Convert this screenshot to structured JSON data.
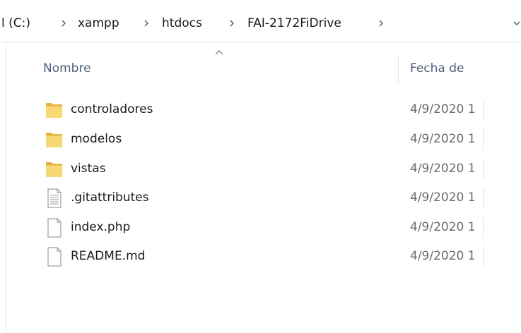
{
  "address_bar": {
    "crumbs": [
      "l (C:)",
      "xampp",
      "htdocs",
      "FAI-2172FiDrive"
    ],
    "separator_icon": "chevron-right-icon",
    "dropdown_icon": "chevron-down-icon"
  },
  "file_list": {
    "sort_icon": "sort-ascending-icon",
    "columns": {
      "name": "Nombre",
      "date": "Fecha de"
    },
    "items": [
      {
        "name": "controladores",
        "date": "4/9/2020 1",
        "type": "folder",
        "icon": "folder-icon"
      },
      {
        "name": "modelos",
        "date": "4/9/2020 1",
        "type": "folder",
        "icon": "folder-icon"
      },
      {
        "name": "vistas",
        "date": "4/9/2020 1",
        "type": "folder",
        "icon": "folder-icon"
      },
      {
        "name": ".gitattributes",
        "date": "4/9/2020 1",
        "type": "text-file",
        "icon": "text-file-icon"
      },
      {
        "name": "index.php",
        "date": "4/9/2020 1",
        "type": "file",
        "icon": "file-icon"
      },
      {
        "name": "README.md",
        "date": "4/9/2020 1",
        "type": "file",
        "icon": "file-icon"
      }
    ]
  },
  "colors": {
    "folder_fill": "#f8d775",
    "folder_shade": "#e5b63f",
    "header_text": "#4d5e77",
    "date_text": "#6b6b6b"
  }
}
